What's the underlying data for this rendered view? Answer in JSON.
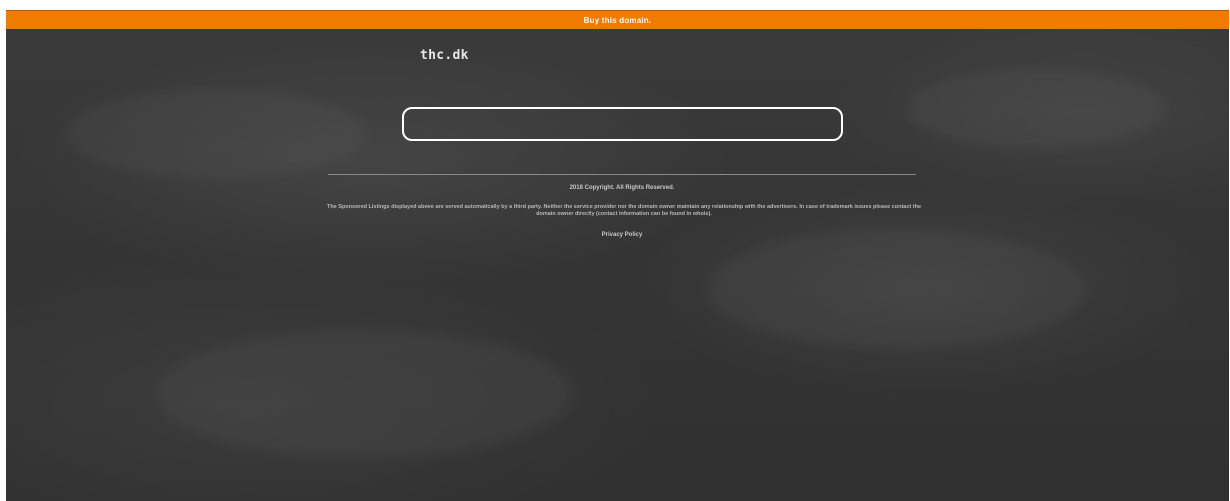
{
  "topbar": {
    "label": "Buy this domain.",
    "color": "#f07b00"
  },
  "header": {
    "title": "thc.dk"
  },
  "search": {
    "value": ""
  },
  "footer": {
    "copyright": "2018 Copyright. All Rights Reserved.",
    "disclaimer": "The Sponsored Listings displayed above are served automatically by a third party. Neither the service provider nor the domain owner maintain any relationship with the advertisers. In case of trademark issues please contact the domain owner directly (contact information can be found in whois).",
    "privacy_label": "Privacy Policy"
  },
  "colors": {
    "background": "#353535",
    "text": "#ffffff"
  }
}
